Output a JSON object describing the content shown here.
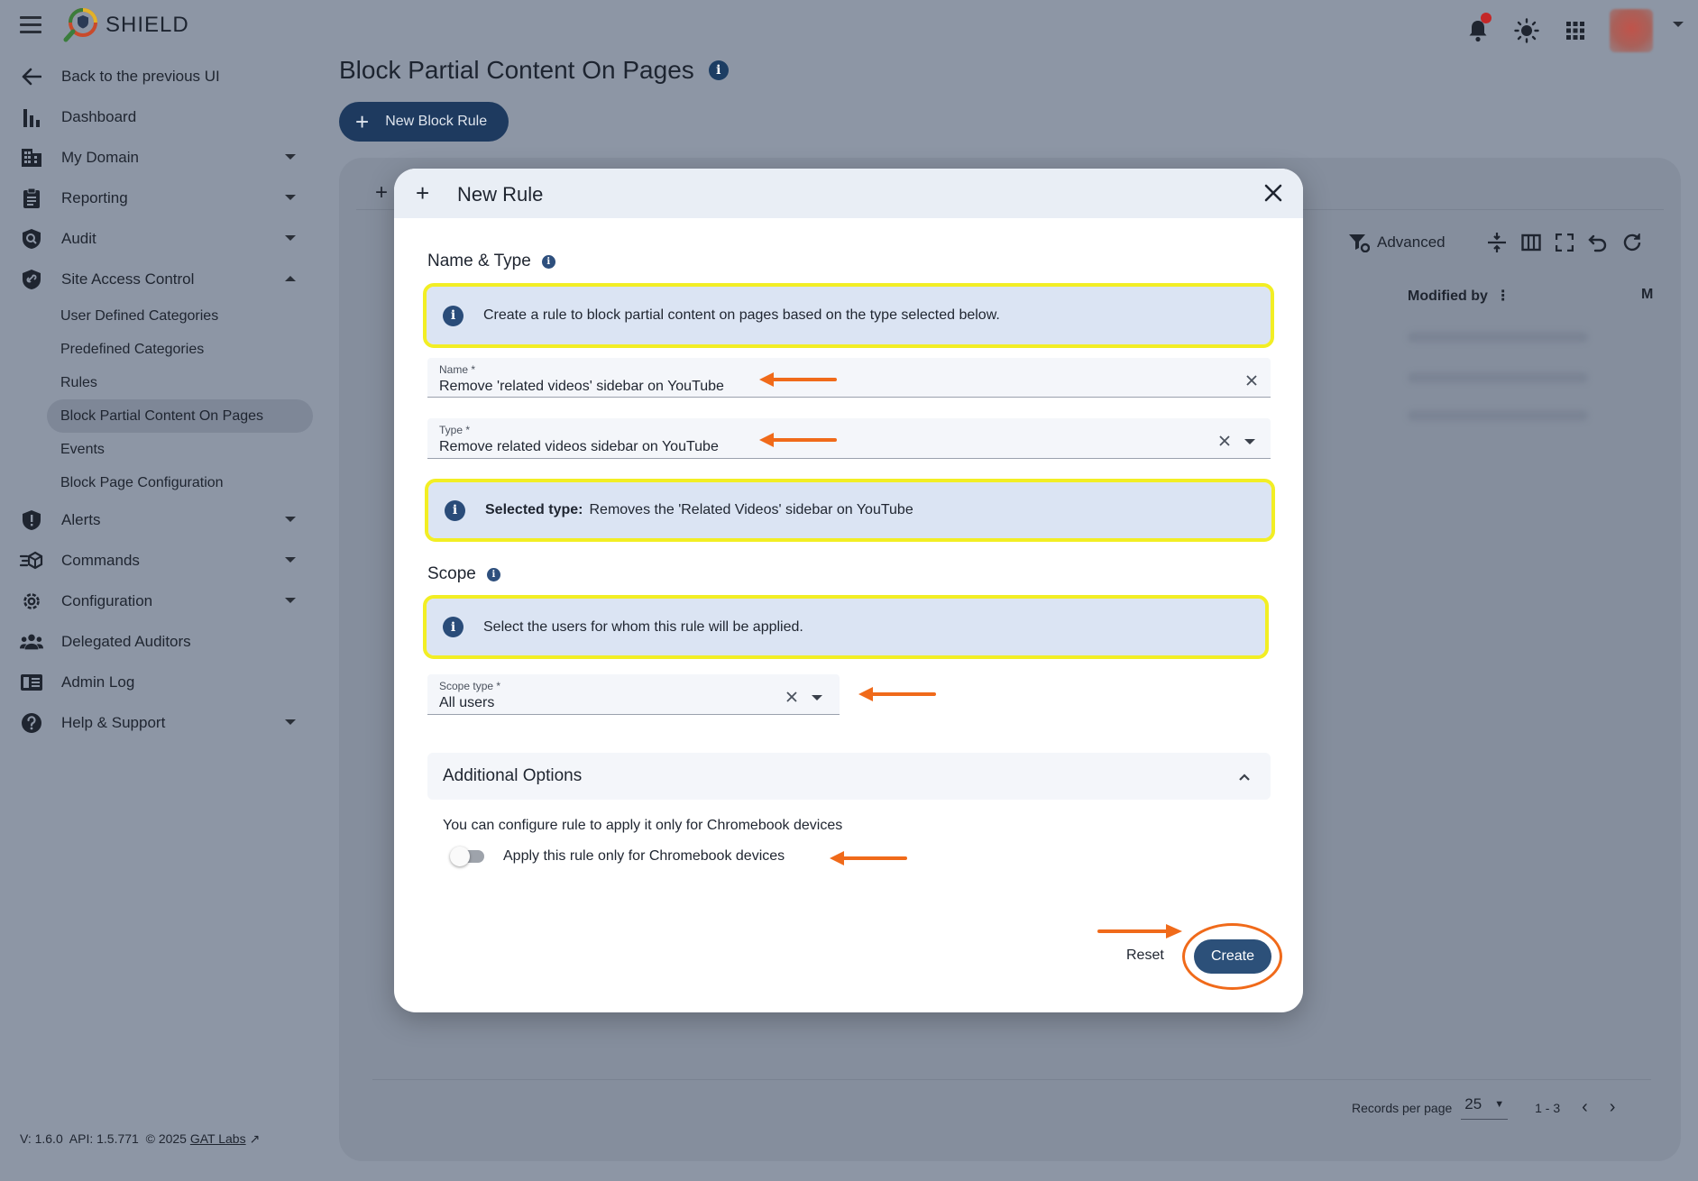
{
  "app": {
    "brand": "SHIELD",
    "page_title": "Block Partial Content On Pages",
    "new_block_rule": "New Block Rule",
    "footer": {
      "version": "V: 1.6.0",
      "api": "API: 1.5.771",
      "copyright": "© 2025",
      "link": "GAT Labs"
    }
  },
  "sidebar": {
    "back": "Back to the previous UI",
    "items": [
      {
        "label": "Dashboard",
        "icon": "bar-chart-icon"
      },
      {
        "label": "My Domain",
        "icon": "building-icon"
      },
      {
        "label": "Reporting",
        "icon": "clipboard-icon"
      },
      {
        "label": "Audit",
        "icon": "audit-shield-icon"
      },
      {
        "label": "Site Access Control",
        "icon": "shield-link-icon"
      },
      {
        "label": "Alerts",
        "icon": "alert-shield-icon"
      },
      {
        "label": "Commands",
        "icon": "commands-icon"
      },
      {
        "label": "Configuration",
        "icon": "gear-icon"
      },
      {
        "label": "Delegated Auditors",
        "icon": "people-icon"
      },
      {
        "label": "Admin Log",
        "icon": "log-icon"
      },
      {
        "label": "Help & Support",
        "icon": "help-icon"
      }
    ],
    "sub_items": [
      "User Defined Categories",
      "Predefined Categories",
      "Rules",
      "Block Partial Content On Pages",
      "Events",
      "Block Page Configuration"
    ]
  },
  "background_table": {
    "advanced": "Advanced",
    "modified_by": "Modified by",
    "next_col": "M",
    "records_per_page_label": "Records per page",
    "records_per_page": "25",
    "range": "1 - 3"
  },
  "modal": {
    "title": "New Rule",
    "name_type_title": "Name & Type",
    "info_create": "Create a rule to block partial content on pages based on the type selected below.",
    "name_label": "Name *",
    "name_value": "Remove 'related videos' sidebar on YouTube",
    "type_label": "Type *",
    "type_value": "Remove related videos sidebar on YouTube",
    "selected_type_label": "Selected type:",
    "selected_type_value": "Removes the 'Related Videos' sidebar on YouTube",
    "scope_title": "Scope",
    "info_scope": "Select the users for whom this rule will be applied.",
    "scope_label": "Scope type *",
    "scope_value": "All users",
    "additional_options": "Additional Options",
    "chromebook_text": "You can configure rule to apply it only for Chromebook devices",
    "toggle_label": "Apply this rule only for Chromebook devices",
    "toggle_on": false,
    "reset": "Reset",
    "create": "Create"
  },
  "colors": {
    "highlight_box": "#f2ee24",
    "annotation_arrow": "#f06a1a",
    "primary_button": "#2c5079",
    "info_banner": "#dbe4f3"
  }
}
